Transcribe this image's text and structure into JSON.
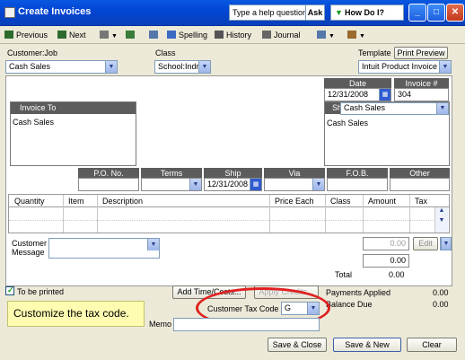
{
  "window": {
    "title": "Create Invoices",
    "help_placeholder": "Type a help question",
    "ask_label": "Ask",
    "howdoi_label": "How Do I?",
    "min": "_",
    "max": "□",
    "close": "✕"
  },
  "toolbar": {
    "previous": "Previous",
    "next": "Next",
    "spelling": "Spelling",
    "history": "History",
    "journal": "Journal"
  },
  "header": {
    "customer_job_label": "Customer:Job",
    "customer_job_value": "Cash Sales",
    "class_label": "Class",
    "class_value": "School:Indr",
    "template_label": "Template",
    "print_preview": "Print Preview",
    "template_value": "Intuit Product Invoice"
  },
  "form": {
    "date_label": "Date",
    "date_value": "12/31/2008",
    "invoice_no_label": "Invoice #",
    "invoice_no_value": "304",
    "invoice_to_label": "Invoice To",
    "invoice_to_value": "Cash Sales",
    "ship_to_label": "Ship To",
    "ship_to_value": "Cash Sales",
    "ship_to_addr": "Cash Sales",
    "po_label": "P.O. No.",
    "terms_label": "Terms",
    "ship_label": "Ship",
    "ship_value": "12/31/2008",
    "via_label": "Via",
    "fob_label": "F.O.B.",
    "other_label": "Other",
    "columns": [
      "Quantity",
      "Item",
      "Description",
      "Price Each",
      "Class",
      "Amount",
      "Tax"
    ],
    "customer_message_label_1": "Customer",
    "customer_message_label_2": "Message",
    "tax_value": "0.00",
    "edit_label": "Edit",
    "total_label": "Total",
    "total_value": "0.00",
    "subtotal_value": "0.00"
  },
  "footer": {
    "to_be_printed": "To be printed",
    "add_time_costs": "Add Time/Costs...",
    "apply_credits": "Apply Credits...",
    "payments_applied_label": "Payments Applied",
    "payments_applied_value": "0.00",
    "balance_due_label": "Balance Due",
    "balance_due_value": "0.00",
    "tip": "Customize the tax code.",
    "customer_tax_code_label": "Customer Tax Code",
    "customer_tax_code_value": "G",
    "memo_label": "Memo",
    "save_close": "Save & Close",
    "save_new": "Save & New",
    "clear": "Clear"
  },
  "colors": {
    "titlebar": "#0046d5",
    "tip_background": "#fdfcb0",
    "highlight_ellipse": "#e02020"
  }
}
